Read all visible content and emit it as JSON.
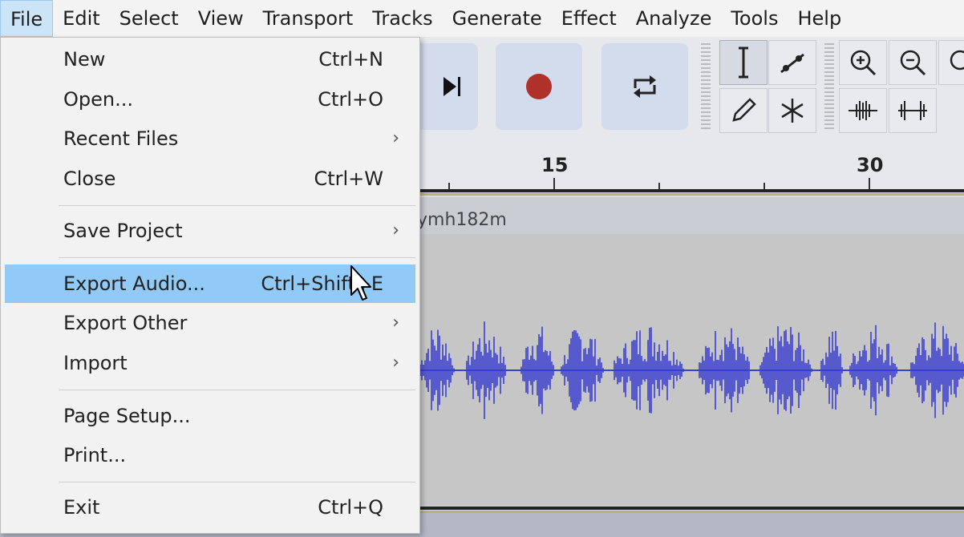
{
  "menubar": {
    "items": [
      "File",
      "Edit",
      "Select",
      "View",
      "Transport",
      "Tracks",
      "Generate",
      "Effect",
      "Analyze",
      "Tools",
      "Help"
    ],
    "active": "File"
  },
  "file_menu": {
    "items": [
      {
        "label": "New",
        "shortcut": "Ctrl+N"
      },
      {
        "label": "Open...",
        "shortcut": "Ctrl+O"
      },
      {
        "label": "Recent Files",
        "submenu": true
      },
      {
        "label": "Close",
        "shortcut": "Ctrl+W"
      },
      {
        "label": "Save Project",
        "submenu": true
      },
      {
        "label": "Export Audio...",
        "shortcut": "Ctrl+Shift+E",
        "highlighted": true
      },
      {
        "label": "Export Other",
        "submenu": true
      },
      {
        "label": "Import",
        "submenu": true
      },
      {
        "label": "Page Setup..."
      },
      {
        "label": "Print..."
      },
      {
        "label": "Exit",
        "shortcut": "Ctrl+Q"
      }
    ],
    "submenu_arrow": "›"
  },
  "ruler": {
    "labels": [
      "15",
      "30"
    ]
  },
  "track": {
    "name": "ymh182m"
  },
  "colors": {
    "waveform": "#3b3fcf",
    "highlight": "#91c9f7",
    "record": "#c0392b"
  },
  "toolbar": {
    "icons": [
      "skip-to-end-icon",
      "record-icon",
      "loop-icon",
      "selection-tool-icon",
      "envelope-tool-icon",
      "draw-tool-icon",
      "multi-tool-icon",
      "zoom-in-icon",
      "zoom-out-icon",
      "fit-selection-icon",
      "trim-audio-icon",
      "silence-audio-icon"
    ]
  }
}
